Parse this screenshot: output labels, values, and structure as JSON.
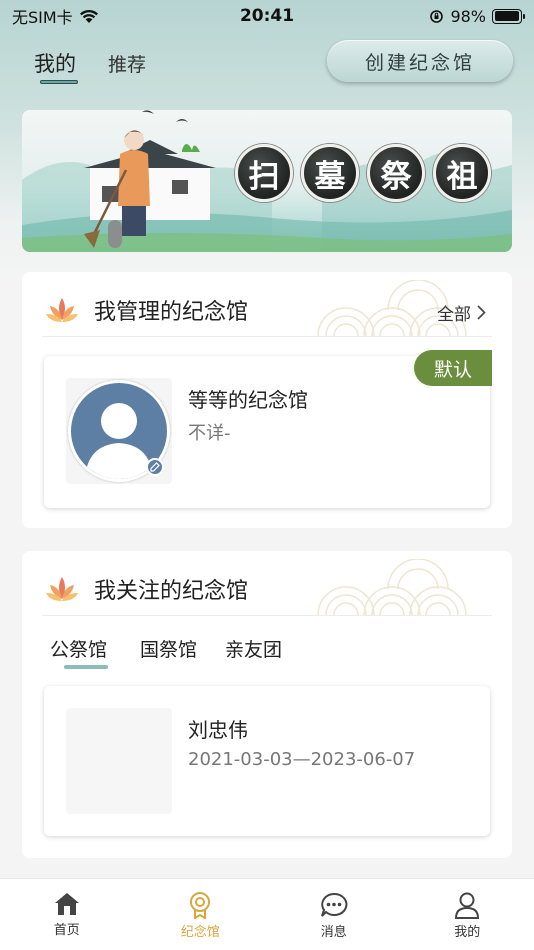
{
  "status_bar": {
    "carrier": "无SIM卡",
    "time": "20:41",
    "battery_percent": "98%",
    "battery_level": 0.98
  },
  "header": {
    "tab_mine": "我的",
    "tab_recommend": "推荐",
    "create_button": "创建纪念馆"
  },
  "banner": {
    "chars": [
      "扫",
      "墓",
      "祭",
      "祖"
    ]
  },
  "managed": {
    "title": "我管理的纪念馆",
    "see_all": "全部",
    "item": {
      "name": "等等的纪念馆",
      "subtitle": "不详-",
      "tag": "默认"
    }
  },
  "followed": {
    "title": "我关注的纪念馆",
    "tabs": [
      "公祭馆",
      "国祭馆",
      "亲友团"
    ],
    "active_tab": 0,
    "item": {
      "name": "刘忠伟",
      "dates": "2021-03-03—2023-06-07"
    }
  },
  "tabbar": {
    "items": [
      {
        "label": "首页",
        "icon": "home-icon"
      },
      {
        "label": "纪念馆",
        "icon": "memorial-icon",
        "active": true
      },
      {
        "label": "消息",
        "icon": "message-icon"
      },
      {
        "label": "我的",
        "icon": "profile-icon"
      }
    ]
  },
  "colors": {
    "accent_teal": "#8dbcb7",
    "tag_green": "#6b8e3e",
    "active_tab": "#d9a640",
    "avatar_blue": "#5d7fa3"
  }
}
